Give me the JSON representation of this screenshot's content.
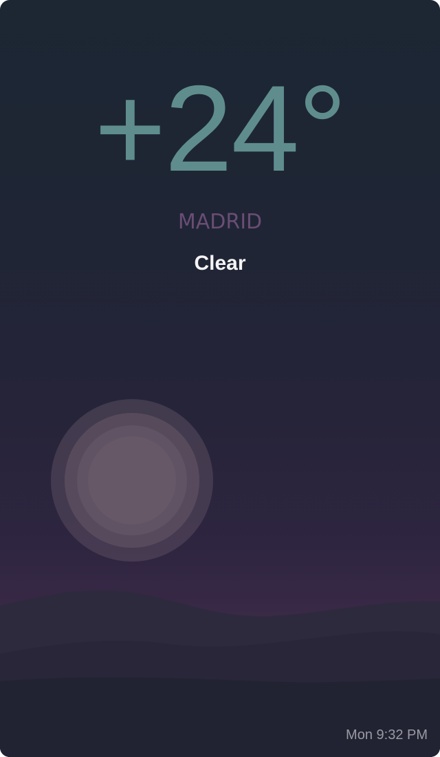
{
  "weather": {
    "temperature": "+24°",
    "city": "MADRID",
    "condition": "Clear",
    "icon": "crescent-moon-icon"
  },
  "footer": {
    "datetime": "Mon 9:32 PM"
  },
  "colors": {
    "temperature": "#5f8d8e",
    "city": "#6a4d75",
    "condition": "#f4f4f4",
    "moon": "#d8c67c",
    "background_top": "#1c2733",
    "background_bottom": "#3a2a47"
  }
}
